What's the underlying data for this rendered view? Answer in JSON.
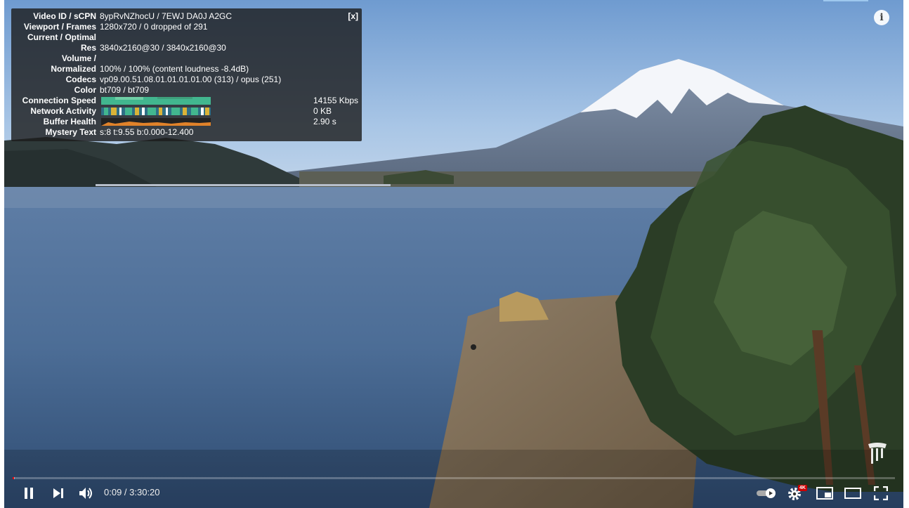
{
  "stats": {
    "close_label": "[x]",
    "rows": [
      {
        "key": "Video ID / sCPN",
        "value": "8ypRvNZhocU / 7EWJ DA0J A2GC"
      },
      {
        "key": "Viewport / Frames",
        "value": "1280x720 / 0 dropped of 291"
      },
      {
        "key": "Current / Optimal",
        "value": ""
      },
      {
        "key": "Res",
        "value": "3840x2160@30 / 3840x2160@30"
      },
      {
        "key": "Volume /",
        "value": ""
      },
      {
        "key": "Normalized",
        "value": "100% / 100% (content loudness -8.4dB)"
      },
      {
        "key": "Codecs",
        "value": "vp09.00.51.08.01.01.01.01.00 (313) / opus (251)"
      },
      {
        "key": "Color",
        "value": "bt709 / bt709"
      },
      {
        "key": "Connection Speed",
        "value": "",
        "right_value": "14155 Kbps"
      },
      {
        "key": "Network Activity",
        "value": "",
        "right_value": "0 KB"
      },
      {
        "key": "Buffer Health",
        "value": "",
        "right_value": "2.90 s"
      },
      {
        "key": "Mystery Text",
        "value": "s:8 t:9.55 b:0.000-12.400"
      }
    ]
  },
  "player": {
    "time_display": "0:09 / 3:30:20",
    "progress_played_fraction": 0.0007,
    "progress_loaded_fraction": 0.001,
    "quality_badge": "4K",
    "autoplay_on": true,
    "colors": {
      "progress_played": "#ff0000",
      "badge": "#cc0000",
      "sky_top": "#7fa6d4",
      "lake": "#4f6f94"
    }
  },
  "icons": {
    "play_pause": "pause-icon",
    "next": "next-icon",
    "volume": "volume-icon",
    "autoplay": "autoplay-toggle-icon",
    "settings": "gear-icon",
    "miniplayer": "miniplayer-icon",
    "theater": "theater-icon",
    "fullscreen": "fullscreen-icon",
    "info": "info-icon"
  }
}
